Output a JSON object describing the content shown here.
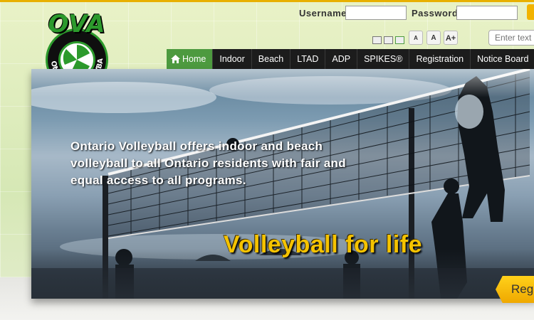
{
  "login": {
    "username_label": "Username",
    "password_label": "Password",
    "username_value": "",
    "password_value": ""
  },
  "font_sizes": [
    "A",
    "A",
    "A+"
  ],
  "search": {
    "placeholder": "Enter text"
  },
  "nav": {
    "items": [
      "Home",
      "Indoor",
      "Beach",
      "LTAD",
      "ADP",
      "SPIKES®",
      "Registration",
      "Notice Board"
    ]
  },
  "hero": {
    "tagline": "Ontario Volleyball offers indoor and beach volleyball to all Ontario residents with fair and equal access to all programs.",
    "slogan": "Volleyball for life",
    "register_tab": "Reg"
  },
  "logo": {
    "acronym": "OVA",
    "ring_text": "ONTARIO VOLLEYBALL"
  },
  "colors": {
    "accent_green": "#4d9a3f",
    "nav_dark": "#1c1c1c",
    "slogan_yellow": "#f5c300",
    "tab_yellow": "#efa800"
  }
}
